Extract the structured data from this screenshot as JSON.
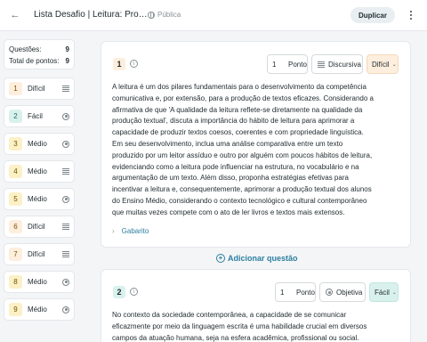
{
  "header": {
    "title": "Lista Desafio | Leitura: Pro…",
    "visibility": "Pública",
    "duplicate_label": "Duplicar"
  },
  "summary": {
    "questions_label": "Questões:",
    "questions_value": "9",
    "points_label": "Total de pontos:",
    "points_value": "9"
  },
  "question_list": [
    {
      "num": "1",
      "level": "Difícil",
      "type": "text"
    },
    {
      "num": "2",
      "level": "Fácil",
      "type": "choice"
    },
    {
      "num": "3",
      "level": "Médio",
      "type": "choice"
    },
    {
      "num": "4",
      "level": "Médio",
      "type": "text"
    },
    {
      "num": "5",
      "level": "Médio",
      "type": "choice"
    },
    {
      "num": "6",
      "level": "Difícil",
      "type": "text"
    },
    {
      "num": "7",
      "level": "Difícil",
      "type": "text"
    },
    {
      "num": "8",
      "level": "Médio",
      "type": "choice"
    },
    {
      "num": "9",
      "level": "Médio",
      "type": "choice"
    }
  ],
  "q1": {
    "num": "1",
    "points_value": "1",
    "points_label": "Ponto",
    "type": "Discursiva",
    "difficulty": "Difícil",
    "text": "A leitura é um dos pilares fundamentais para o desenvolvimento da competência comunicativa e, por extensão, para a produção de textos eficazes. Considerando a afirmativa de que 'A qualidade da leitura reflete-se diretamente na qualidade da produção textual', discuta a importância do hábito de leitura para aprimorar a capacidade de produzir textos coesos, coerentes e com propriedade linguística. Em seu desenvolvimento, inclua uma análise comparativa entre um texto produzido por um leitor assíduo e outro por alguém com poucos hábitos de leitura, evidenciando como a leitura pode influenciar na estrutura, no vocabulário e na argumentação de um texto. Além disso, proponha estratégias efetivas para incentivar a leitura e, consequentemente, aprimorar a produção textual dos alunos do Ensino Médio, considerando o contexto tecnológico e cultural contemporâneo que muitas vezes compete com o ato de ler livros e textos mais extensos.",
    "answer_label": "Gabarito"
  },
  "add_question_label": "Adicionar questão",
  "q2": {
    "num": "2",
    "points_value": "1",
    "points_label": "Ponto",
    "type": "Objetiva",
    "difficulty": "Fácil",
    "text": "No contexto da sociedade contemporânea, a capacidade de se comunicar eficazmente por meio da linguagem escrita é uma habilidade crucial em diversos campos da atuação humana, seja na esfera acadêmica, profissional ou social. Para"
  }
}
